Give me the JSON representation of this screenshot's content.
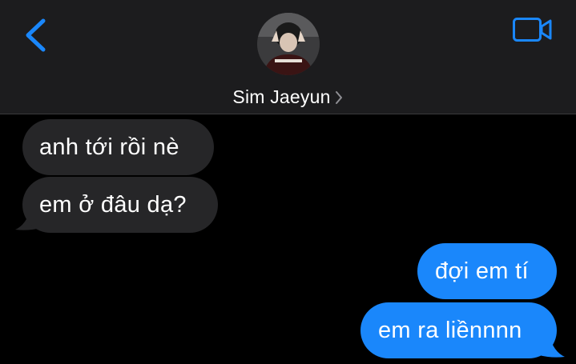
{
  "header": {
    "contact_name": "Sim Jaeyun",
    "back_icon": "chevron-left-icon",
    "video_icon": "video-camera-icon",
    "accent_color": "#1a87fb"
  },
  "messages": [
    {
      "direction": "incoming",
      "text": "anh tới rồi nè"
    },
    {
      "direction": "incoming",
      "text": "em ở đâu dạ?"
    },
    {
      "direction": "outgoing",
      "text": "đợi em tí"
    },
    {
      "direction": "outgoing",
      "text": "em ra liềnnnn"
    }
  ],
  "colors": {
    "background": "#000000",
    "header_bg": "#1c1c1e",
    "incoming_bubble": "#262628",
    "outgoing_bubble": "#1a87fb"
  }
}
